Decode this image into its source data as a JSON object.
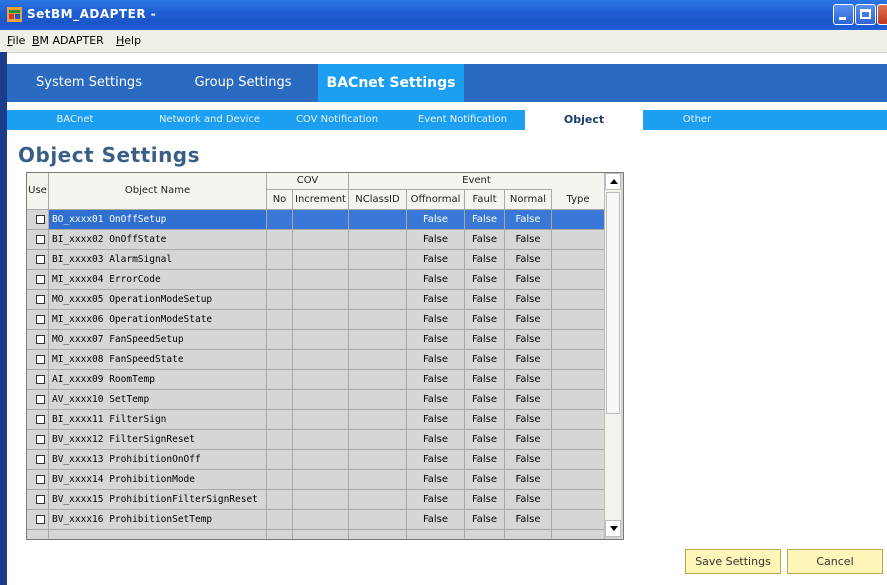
{
  "window": {
    "title": "SetBM_ADAPTER -",
    "icon": "app-icon"
  },
  "menu": [
    {
      "label": "File",
      "mnemonic": "F",
      "rest": "ile"
    },
    {
      "label": "BM ADAPTER",
      "mnemonic": "B",
      "rest": "M ADAPTER"
    },
    {
      "label": "Help",
      "mnemonic": "H",
      "rest": "elp"
    }
  ],
  "main_tabs": [
    "System Settings",
    "Group Settings",
    "BACnet Settings"
  ],
  "main_tab_active": "BACnet Settings",
  "sub_tabs": [
    "BACnet",
    "Network and Device",
    "COV Notification",
    "Event Notification",
    "Object",
    "Other"
  ],
  "sub_tab_active": "Object",
  "page_title": "Object Settings",
  "table": {
    "headers": {
      "use": "Use",
      "object_name": "Object Name",
      "cov_group": "COV",
      "cov_no": "No",
      "cov_increment": "Increment",
      "event_group": "Event",
      "nclassid": "NClassID",
      "offnormal": "Offnormal",
      "fault": "Fault",
      "normal": "Normal",
      "type": "Type"
    },
    "rows": [
      {
        "name": "BO_xxxx01 OnOffSetup",
        "offnormal": "False",
        "fault": "False",
        "normal": "False"
      },
      {
        "name": "BI_xxxx02 OnOffState",
        "offnormal": "False",
        "fault": "False",
        "normal": "False"
      },
      {
        "name": "BI_xxxx03 AlarmSignal",
        "offnormal": "False",
        "fault": "False",
        "normal": "False"
      },
      {
        "name": "MI_xxxx04 ErrorCode",
        "offnormal": "False",
        "fault": "False",
        "normal": "False"
      },
      {
        "name": "MO_xxxx05 OperationModeSetup",
        "offnormal": "False",
        "fault": "False",
        "normal": "False"
      },
      {
        "name": "MI_xxxx06 OperationModeState",
        "offnormal": "False",
        "fault": "False",
        "normal": "False"
      },
      {
        "name": "MO_xxxx07 FanSpeedSetup",
        "offnormal": "False",
        "fault": "False",
        "normal": "False"
      },
      {
        "name": "MI_xxxx08 FanSpeedState",
        "offnormal": "False",
        "fault": "False",
        "normal": "False"
      },
      {
        "name": "AI_xxxx09 RoomTemp",
        "offnormal": "False",
        "fault": "False",
        "normal": "False"
      },
      {
        "name": "AV_xxxx10 SetTemp",
        "offnormal": "False",
        "fault": "False",
        "normal": "False"
      },
      {
        "name": "BI_xxxx11 FilterSign",
        "offnormal": "False",
        "fault": "False",
        "normal": "False"
      },
      {
        "name": "BV_xxxx12 FilterSignReset",
        "offnormal": "False",
        "fault": "False",
        "normal": "False"
      },
      {
        "name": "BV_xxxx13 ProhibitionOnOff",
        "offnormal": "False",
        "fault": "False",
        "normal": "False"
      },
      {
        "name": "BV_xxxx14 ProhibitionMode",
        "offnormal": "False",
        "fault": "False",
        "normal": "False"
      },
      {
        "name": "BV_xxxx15 ProhibitionFilterSignReset",
        "offnormal": "False",
        "fault": "False",
        "normal": "False"
      },
      {
        "name": "BV_xxxx16 ProhibitionSetTemp",
        "offnormal": "False",
        "fault": "False",
        "normal": "False"
      }
    ],
    "selected_row": 0
  },
  "buttons": {
    "save": "Save Settings",
    "cancel": "Cancel"
  },
  "colors": {
    "titlebar": "#1f5fd3",
    "main_tabs": "#2a6ac0",
    "accent": "#1c9ff0",
    "selection": "#2f6fd1",
    "button": "#fdf6b8"
  }
}
